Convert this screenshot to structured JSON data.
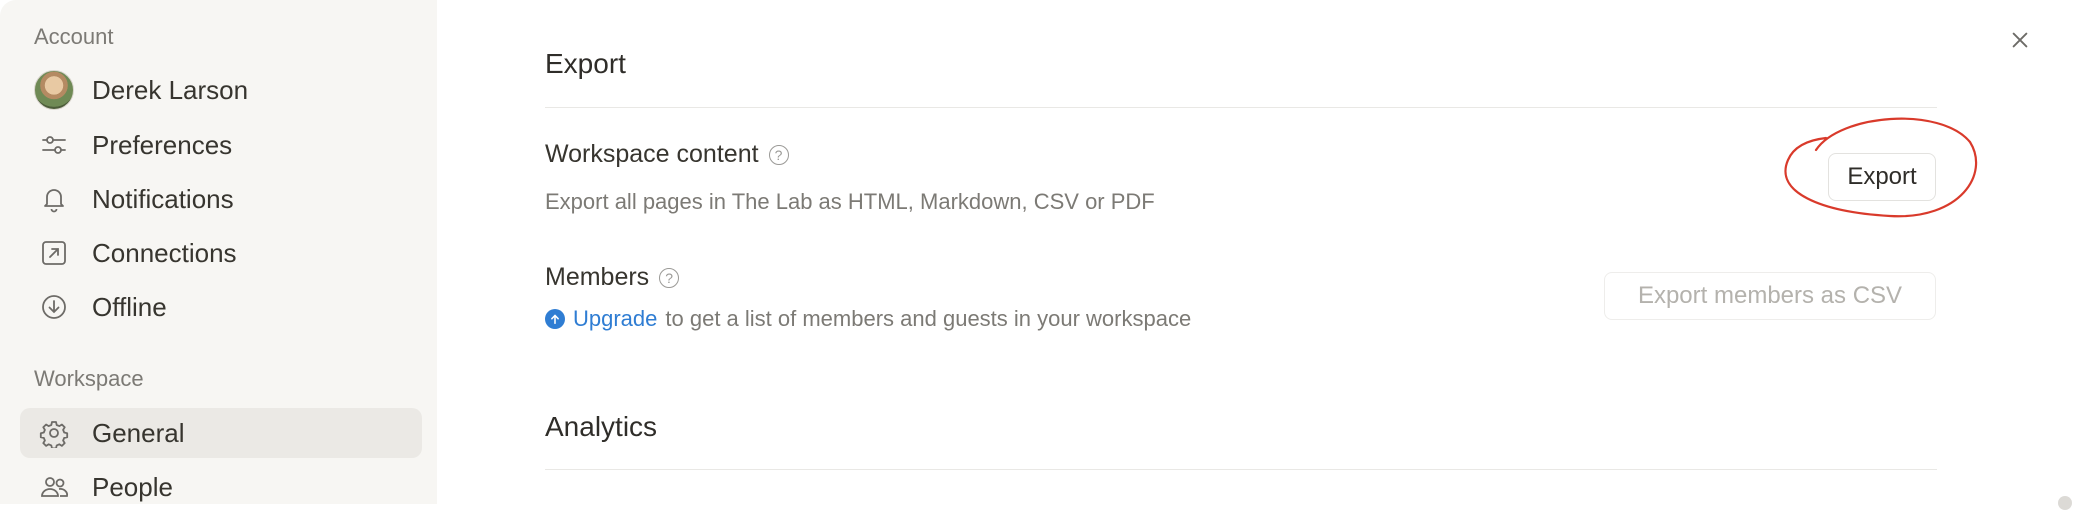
{
  "sidebar": {
    "account_label": "Account",
    "user_name": "Derek Larson",
    "items": [
      {
        "label": "Preferences",
        "icon": "sliders-icon"
      },
      {
        "label": "Notifications",
        "icon": "bell-icon"
      },
      {
        "label": "Connections",
        "icon": "arrow-up-right-box-icon"
      },
      {
        "label": "Offline",
        "icon": "download-circle-icon"
      }
    ],
    "workspace_label": "Workspace",
    "workspace_items": [
      {
        "label": "General",
        "icon": "gear-icon",
        "active": true
      },
      {
        "label": "People",
        "icon": "people-icon",
        "active": false
      }
    ]
  },
  "main": {
    "export_heading": "Export",
    "workspace_content": {
      "title": "Workspace content",
      "help": "?",
      "description": "Export all pages in The Lab as HTML, Markdown, CSV or PDF",
      "button_label": "Export"
    },
    "members": {
      "title": "Members",
      "help": "?",
      "upgrade_link": "Upgrade",
      "description": "to get a list of members and guests in your workspace",
      "button_label": "Export members as CSV"
    },
    "analytics_heading": "Analytics"
  },
  "colors": {
    "sidebar_bg": "#f7f6f3",
    "active_bg": "#ebe9e5",
    "link": "#2f7dd3",
    "annotation": "#d93a2b"
  }
}
